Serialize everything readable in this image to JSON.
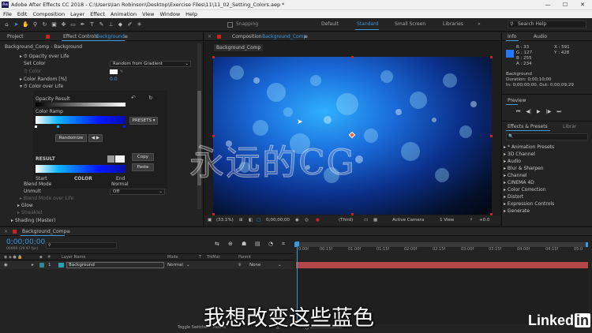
{
  "title_bar": {
    "app_icon": "Ae",
    "title": "Adobe After Effects CC 2018 - C:\\Users\\Ian Robinson\\Desktop\\Exercise Files\\11\\11_02_Setting_Colors.aep *",
    "minimize": "—",
    "maximize": "☐",
    "close": "✕"
  },
  "menu": [
    "File",
    "Edit",
    "Composition",
    "Layer",
    "Effect",
    "Animation",
    "View",
    "Window",
    "Help"
  ],
  "toolbar": {
    "snapping": "Snapping",
    "workspaces": [
      "Default",
      "Standard",
      "Small Screen",
      "Libraries"
    ],
    "active_workspace": "Standard",
    "search_help": "Search Help",
    "overflow": "»"
  },
  "left_panel": {
    "tabs": [
      "Project",
      "Effect Controls",
      "Background"
    ],
    "menu_icon": "≡",
    "path": "Background_Comp - Background",
    "rows": {
      "opacity_over_life": "Opacity over Life",
      "set_color": "Set Color",
      "set_color_value": "Random from Gradient",
      "color": "Color",
      "color_random": "Color Random [%]",
      "color_random_value": "0.0",
      "color_over_life": "Color over Life",
      "opacity_result": "Opacity Result",
      "color_ramp": "Color Ramp",
      "presets": "PRESETS",
      "randomize": "Randomize",
      "swap": "◀ ▶",
      "copy": "Copy",
      "paste": "Paste",
      "result": "RESULT",
      "start": "Start",
      "color_label": "COLOR",
      "end": "End",
      "blend_mode": "Blend Mode",
      "blend_mode_value": "Normal",
      "unmult": "Unmult",
      "unmult_value": "Off",
      "blend_mode_over_life": "Blend Mode over Life",
      "glow": "Glow",
      "streaklet": "Streaklet",
      "shading": "Shading (Master)"
    }
  },
  "comp_panel": {
    "tab_label": "Composition",
    "tab_name": "Background_Comp",
    "menu_icon": "≡",
    "breadcrumb": "Background_Comp",
    "zoom": "(33.1%)",
    "timecode": "0;00;00;00",
    "resolution": "(Third)",
    "camera": "Active Camera",
    "views": "1 View",
    "exposure": "+0.0"
  },
  "info_panel": {
    "tabs": [
      "Info",
      "Audio"
    ],
    "r": "R : 33",
    "g": "G : 127",
    "b": "B : 255",
    "a": "A : 234",
    "x": "X : 591",
    "y": "Y : 428",
    "sample_color": "#2178ff",
    "layer": "Background",
    "duration": "Duration: 0;00;10;00",
    "in_out": "In: 0;00;00;00, Out: 0;00;09;29"
  },
  "preview_panel": {
    "title": "Preview",
    "controls": [
      "⏮",
      "◀|",
      "▶",
      "|▶",
      "⏭"
    ]
  },
  "effects_panel": {
    "tabs": [
      "Effects & Presets",
      "Librar"
    ],
    "search_placeholder": "🔍",
    "categories": [
      "* Animation Presets",
      "3D Channel",
      "Audio",
      "Blur & Sharpen",
      "Channel",
      "CINEMA 4D",
      "Color Correction",
      "Distort",
      "Expression Controls",
      "Generate"
    ]
  },
  "timeline": {
    "comp_name": "Background_Comp",
    "menu_icon": "≡",
    "timecode": "0;00;00;00",
    "fps": "00000 (29.97 fps)",
    "columns": {
      "layer_name": "Layer Name",
      "mode": "Mode",
      "t": "T",
      "trkmat": "TrkMat",
      "parent": "Parent"
    },
    "layer": {
      "index": "1",
      "name": "Background",
      "mode": "Normal",
      "parent": "None"
    },
    "ruler": [
      "0:00f",
      "00:15f",
      "01:00f",
      "01:15f",
      "02:00f",
      "02:15f",
      "03:00f",
      "03:15f",
      "04:00f",
      "04:15f",
      "05:0"
    ],
    "footer": "Toggle Switches / Modes",
    "label_color": "#2d8a8a",
    "bar_color": "#b5474a"
  },
  "overlay": {
    "watermark": "永远的CG",
    "subtitle": "我想改变这些蓝色",
    "brand": "Linked",
    "brand_in": "in"
  }
}
